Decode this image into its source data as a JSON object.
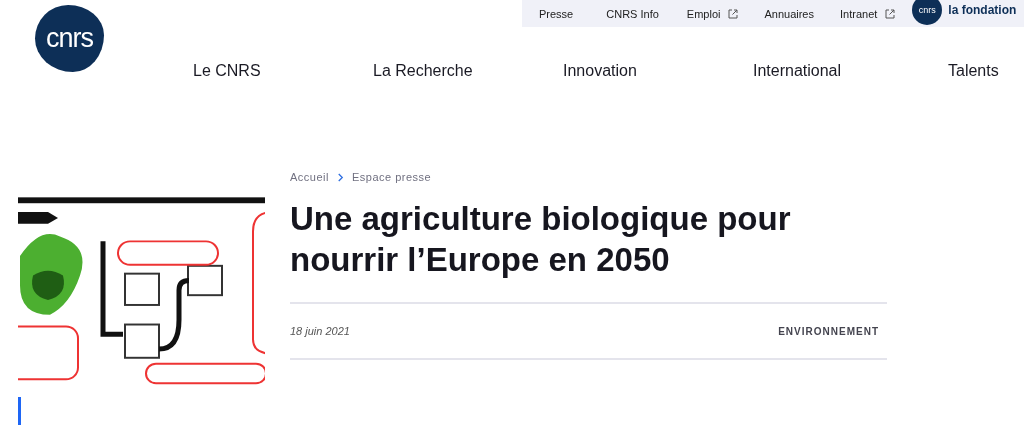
{
  "logo": {
    "text": "cnrs"
  },
  "utility_links": [
    {
      "label": "Presse",
      "external": false
    },
    {
      "label": "CNRS Info",
      "external": false
    },
    {
      "label": "Emploi",
      "external": true
    },
    {
      "label": "Annuaires",
      "external": false
    },
    {
      "label": "Intranet",
      "external": true
    }
  ],
  "foundation_logo": {
    "mark": "cnrs",
    "text": "la fondation"
  },
  "main_nav": [
    "Le CNRS",
    "La Recherche",
    "Innovation",
    "International",
    "Talents"
  ],
  "breadcrumb": [
    "Accueil",
    "Espace presse"
  ],
  "title": "Une agriculture biologique pour nourrir l’Europe en 2050",
  "date": "18 juin 2021",
  "category": "ENVIRONNEMENT"
}
